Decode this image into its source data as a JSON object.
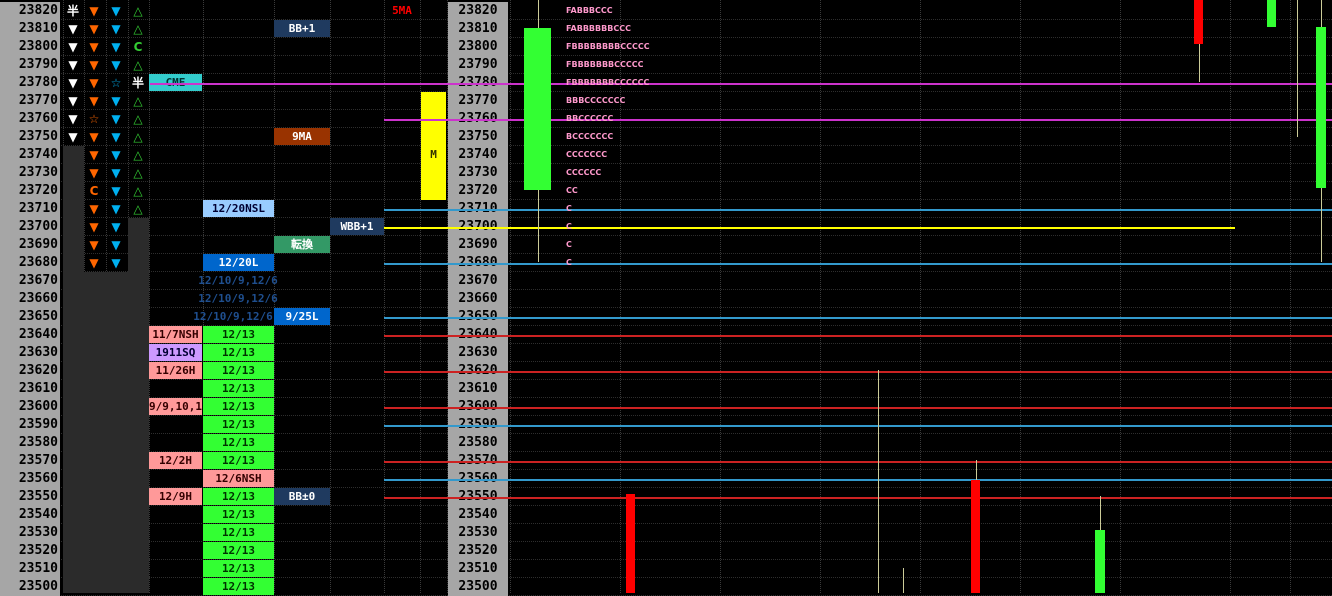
{
  "prices": [
    "23820",
    "23810",
    "23800",
    "23790",
    "23780",
    "23770",
    "23760",
    "23750",
    "23740",
    "23730",
    "23720",
    "23710",
    "23700",
    "23690",
    "23680",
    "23670",
    "23660",
    "23650",
    "23640",
    "23630",
    "23620",
    "23610",
    "23600",
    "23590",
    "23580",
    "23570",
    "23560",
    "23550",
    "23540",
    "23530",
    "23520",
    "23510",
    "23500"
  ],
  "colors": {
    "background": "#000000",
    "price_column": "#a6a6a6",
    "orange": "#ff6600",
    "cyan": "#00b0f0",
    "green_tri": "#33cc33",
    "lime": "#33ff33",
    "red": "#ff0000",
    "pink": "#ff99cc",
    "magenta": "#cc33cc",
    "blue_line": "#3399cc",
    "yellow": "#ffff00"
  },
  "symbols": {
    "col1": [
      "半",
      "▼",
      "▼",
      "▼",
      "▼",
      "▼",
      "▼",
      "▼",
      "",
      "",
      "",
      "",
      "",
      "",
      "",
      "",
      "",
      "",
      "",
      "",
      "",
      "",
      "",
      "",
      "",
      "",
      "",
      "",
      "",
      "",
      "",
      "",
      ""
    ],
    "col2": [
      "▼",
      "▼",
      "▼",
      "▼",
      "▼",
      "▼",
      "☆",
      "▼",
      "▼",
      "▼",
      "C",
      "▼",
      "▼",
      "▼",
      "▼",
      "",
      "",
      "",
      "",
      "",
      "",
      "",
      "",
      "",
      "",
      "",
      "",
      "",
      "",
      "",
      "",
      "",
      ""
    ],
    "col3": [
      "▼",
      "▼",
      "▼",
      "▼",
      "☆",
      "▼",
      "▼",
      "▼",
      "▼",
      "▼",
      "▼",
      "▼",
      "▼",
      "▼",
      "▼",
      "",
      "",
      "",
      "",
      "",
      "",
      "",
      "",
      "",
      "",
      "",
      "",
      "",
      "",
      "",
      "",
      "",
      ""
    ],
    "col4": [
      "△",
      "△",
      "C",
      "△",
      "半",
      "△",
      "△",
      "△",
      "△",
      "△",
      "△",
      "△",
      "",
      "",
      "",
      "",
      "",
      "",
      "",
      "",
      "",
      "",
      "",
      "",
      "",
      "",
      "",
      "",
      "",
      "",
      "",
      "",
      ""
    ]
  },
  "labels": {
    "cme": "CME",
    "bb_plus1": "BB+1",
    "nine_ma": "9MA",
    "five_ma": "5MA",
    "nsl_1220": "12/20NSL",
    "wbb_plus1": "WBB+1",
    "tenkan": "転換",
    "l_1220": "12/20L",
    "multi_1": "12/10/9,12/6",
    "multi_2": "12/10/9,12/6",
    "multi_3": "12/10/9,12/6",
    "l_925": "9/25L",
    "nsh_117": "11/7NSH",
    "sq_1911": "1911SQ",
    "h_1126": "11/26H",
    "multi_4": "9/9,10,1",
    "h_122": "12/2H",
    "nsh_126": "12/6NSH",
    "h_129": "12/9H",
    "bb_pm0": "BB±0",
    "m_marker": "M",
    "d1213": "12/13"
  },
  "tpo": {
    "r23820": "FABBBCCC",
    "r23810": "FABBBBBBCCC",
    "r23800": "FBBBBBBBBCCCCC",
    "r23790": "FBBBBBBBCCCCC",
    "r23780": "FBBBBBBBCCCCCC",
    "r23770": "BBBCCCCCCC",
    "r23760": "BBCCCCCC",
    "r23750": "BCCCCCCC",
    "r23740": "CCCCCCC",
    "r23730": "CCCCCC",
    "r23720": "CC",
    "r23710": "C",
    "r23700": "C",
    "r23690": "C",
    "r23680": "C"
  }
}
